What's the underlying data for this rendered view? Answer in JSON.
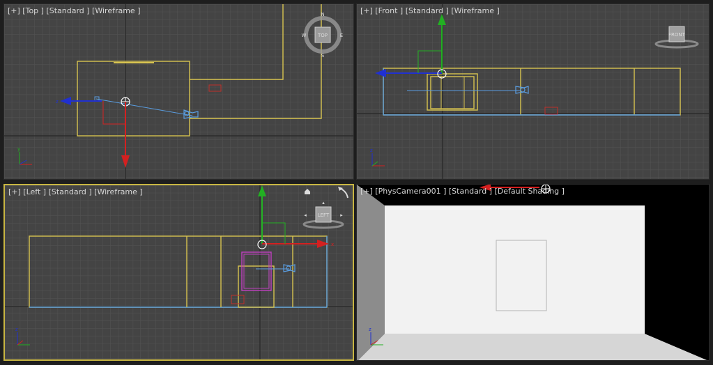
{
  "viewports": {
    "top": {
      "label": "[+] [Top ] [Standard ] [Wireframe ]",
      "viewcube": "TOP",
      "compass": {
        "n": "N",
        "s": "S",
        "e": "E",
        "w": "W"
      }
    },
    "front": {
      "label": "[+] [Front ] [Standard ] [Wireframe ]",
      "viewcube": "FRONT"
    },
    "left": {
      "label": "[+] [Left ] [Standard ] [Wireframe ]",
      "viewcube": "LEFT"
    },
    "camera": {
      "label": "[+] [PhysCamera001 ] [Standard ] [Default Shading ]"
    }
  },
  "axis_labels": {
    "x": "x",
    "y": "y",
    "z": "z"
  },
  "colors": {
    "viewport_bg": "#444444",
    "grid": "#535353",
    "grid_major": "#2f2f2f",
    "active_border": "#c8b642",
    "wire_yellow": "#d8c450",
    "axis_x": "#d42020",
    "axis_y": "#22b022",
    "axis_z": "#2030d0",
    "camera_blue": "#5a9de0"
  },
  "icons": [
    "viewcube-icon",
    "compass-icon",
    "camera-icon",
    "target-icon",
    "home-icon",
    "orbit-icon",
    "axis-tripod-icon"
  ]
}
